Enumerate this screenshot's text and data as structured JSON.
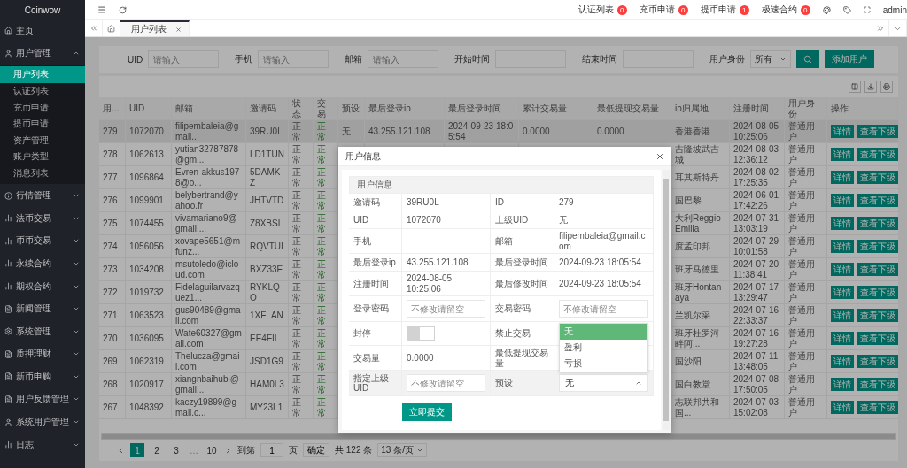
{
  "sidebar": {
    "brand": "Coinwow",
    "items": [
      {
        "label": "主页",
        "kind": "link"
      },
      {
        "label": "用户管理",
        "kind": "group",
        "expanded": true,
        "children": [
          {
            "label": "用户列表",
            "selected": true
          },
          {
            "label": "认证列表",
            "selected": false
          },
          {
            "label": "充币申请",
            "selected": false
          },
          {
            "label": "提币申请",
            "selected": false
          },
          {
            "label": "资产管理",
            "selected": false
          },
          {
            "label": "账户类型",
            "selected": false
          },
          {
            "label": "消息列表",
            "selected": false
          }
        ]
      },
      {
        "label": "行情管理",
        "kind": "group",
        "expanded": false
      },
      {
        "label": "法币交易",
        "kind": "group",
        "expanded": false
      },
      {
        "label": "币币交易",
        "kind": "group",
        "expanded": false
      },
      {
        "label": "永续合约",
        "kind": "group",
        "expanded": false
      },
      {
        "label": "期权合约",
        "kind": "group",
        "expanded": false
      },
      {
        "label": "新闻管理",
        "kind": "group",
        "expanded": false
      },
      {
        "label": "系统管理",
        "kind": "group",
        "expanded": false
      },
      {
        "label": "质押理财",
        "kind": "group",
        "expanded": false
      },
      {
        "label": "新币申购",
        "kind": "group",
        "expanded": false
      },
      {
        "label": "用户反馈管理",
        "kind": "group",
        "expanded": false
      },
      {
        "label": "系统用户管理",
        "kind": "group",
        "expanded": false
      },
      {
        "label": "日志",
        "kind": "group",
        "expanded": false
      }
    ]
  },
  "topbar": {
    "badges": [
      {
        "label": "认证列表",
        "count": "0"
      },
      {
        "label": "充币申请",
        "count": "0"
      },
      {
        "label": "提币申请",
        "count": "1"
      },
      {
        "label": "极速合约",
        "count": "0"
      }
    ],
    "user": "admin"
  },
  "tabs": [
    {
      "label": "用户列表",
      "selected": true
    }
  ],
  "filters": {
    "fields": [
      {
        "label": "UID",
        "placeholder": "请输入"
      },
      {
        "label": "手机",
        "placeholder": "请输入"
      },
      {
        "label": "邮箱",
        "placeholder": "请输入"
      },
      {
        "label": "开始时间"
      },
      {
        "label": "结束时间"
      }
    ],
    "role": {
      "label": "用户身份",
      "value": "所有"
    },
    "add_button": "添加用户"
  },
  "table": {
    "columns": [
      "用...",
      "UID",
      "邮箱",
      "邀请码",
      "状态",
      "交易",
      "预设",
      "最后登录ip",
      "最后登录时间",
      "累计交易量",
      "最低提现交易量",
      "ip归属地",
      "注册时间",
      "用户身份",
      "操作"
    ],
    "rows": [
      {
        "highlighted": true,
        "front": [
          "279",
          "1072070",
          "filipembaleia@gmail...",
          "39RU0L",
          "正常",
          "正常"
        ],
        "middle": [
          "无",
          "43.255.121.108",
          "2024-09-23 18:05:54",
          "0.0000",
          "0.0000"
        ],
        "back": [
          "香港香港",
          "2024-08-05 10:25:06",
          "普通用户"
        ],
        "actions": [
          "详情",
          "查看下级"
        ]
      },
      {
        "highlighted": false,
        "front": [
          "278",
          "1062613",
          "yutian32787878@gm...",
          "LD1TUN",
          "正常",
          "正常"
        ],
        "back": [
          "吉隆坡武吉城",
          "2024-08-03 12:36:12",
          "普通用户"
        ],
        "actions": [
          "详情",
          "查看下级"
        ]
      },
      {
        "highlighted": false,
        "front": [
          "277",
          "1096864",
          "Evren-akkus1978@o...",
          "5DAMKZ",
          "正常",
          "正常"
        ],
        "back": [
          "耳其斯特丹",
          "2024-08-02 17:25:35",
          "普通用户"
        ],
        "actions": [
          "详情",
          "查看下级"
        ]
      },
      {
        "highlighted": false,
        "front": [
          "276",
          "1099901",
          "belybertrand@yahoo.fr",
          "JHTVTD",
          "正常",
          "正常"
        ],
        "back": [
          "国巴黎",
          "2024-06-01 17:42:26",
          "普通用户"
        ],
        "actions": [
          "详情",
          "查看下级"
        ]
      },
      {
        "highlighted": false,
        "front": [
          "275",
          "1074455",
          "vivamariano9@gmail....",
          "Z8XBSL",
          "正常",
          "正常"
        ],
        "back": [
          "大利Reggio Emilia",
          "2024-07-31 13:03:19",
          "普通用户"
        ],
        "actions": [
          "详情",
          "查看下级"
        ]
      },
      {
        "highlighted": false,
        "front": [
          "274",
          "1056056",
          "xovape5651@mfunz...",
          "RQVTUI",
          "正常",
          "正常"
        ],
        "back": [
          "度孟印邦",
          "2024-07-29 10:01:58",
          "普通用户"
        ],
        "actions": [
          "详情",
          "查看下级"
        ]
      },
      {
        "highlighted": false,
        "front": [
          "273",
          "1034208",
          "msutoledo@icloud.com",
          "BXZ33E",
          "正常",
          "正常"
        ],
        "back": [
          "班牙马德里",
          "2024-07-20 11:38:41",
          "普通用户"
        ],
        "actions": [
          "详情",
          "查看下级"
        ]
      },
      {
        "highlighted": false,
        "front": [
          "272",
          "1019732",
          "Fidelaguilarvazquez1...",
          "RYKLQO",
          "正常",
          "正常"
        ],
        "back": [
          "班牙Hontanaya",
          "2024-07-17 13:29:47",
          "普通用户"
        ],
        "actions": [
          "详情",
          "查看下级"
        ]
      },
      {
        "highlighted": false,
        "front": [
          "271",
          "1063523",
          "gus90489@gmail.com",
          "1XFLAN",
          "正常",
          "正常"
        ],
        "back": [
          "兰凯尔采",
          "2024-07-16 22:33:37",
          "普通用户"
        ],
        "actions": [
          "详情",
          "查看下级"
        ]
      },
      {
        "highlighted": false,
        "front": [
          "270",
          "1036095",
          "Wate60327@gmail.com",
          "EE4FII",
          "正常",
          "正常"
        ],
        "back": [
          "班牙杜罗河畔阿...",
          "2024-07-16 19:27:28",
          "普通用户"
        ],
        "actions": [
          "详情",
          "查看下级"
        ]
      },
      {
        "highlighted": false,
        "front": [
          "269",
          "1062319",
          "Thelucza@gmail.com",
          "JSD1G9",
          "正常",
          "正常"
        ],
        "back": [
          "国沙阳",
          "2024-07-11 13:48:05",
          "普通用户"
        ],
        "actions": [
          "详情",
          "查看下级"
        ]
      },
      {
        "highlighted": false,
        "front": [
          "268",
          "1020917",
          "xiangnbaihubi@gmail...",
          "HAM0L3",
          "正常",
          "正常"
        ],
        "back": [
          "国白教堂",
          "2024-07-08 17:50:05",
          "普通用户"
        ],
        "actions": [
          "详情",
          "查看下级"
        ]
      },
      {
        "highlighted": false,
        "front": [
          "267",
          "1048392",
          "kaczy19899@gmail.c...",
          "MY23L1",
          "正常",
          "正常"
        ],
        "back": [
          "志联邦共和国...",
          "2024-07-03 15:02:08",
          "普通用户"
        ],
        "actions": [
          "详情",
          "查看下级"
        ]
      }
    ]
  },
  "pagination": {
    "pages": [
      {
        "label": "1",
        "kind": "page",
        "selected": true
      },
      {
        "label": "2",
        "kind": "page",
        "selected": false
      },
      {
        "label": "3",
        "kind": "page",
        "selected": false
      },
      {
        "label": "…",
        "kind": "ellipsis",
        "selected": false
      },
      {
        "label": "10",
        "kind": "page",
        "selected": false
      }
    ],
    "goto_label": "到第",
    "goto_value": "1",
    "page_unit": "页",
    "confirm": "确定",
    "total": "共 122 条",
    "page_size": "13 条/页"
  },
  "modal": {
    "title": "用户信息",
    "section": "用户信息",
    "submit": "立即提交",
    "rows": [
      {
        "highlighted": false,
        "cells": [
          {
            "kind": "text",
            "label": "邀请码",
            "value": "39RU0L"
          },
          {
            "kind": "text",
            "label": "ID",
            "value": "279"
          }
        ]
      },
      {
        "highlighted": false,
        "cells": [
          {
            "kind": "text",
            "label": "UID",
            "value": "1072070"
          },
          {
            "kind": "text",
            "label": "上级UID",
            "value": "无"
          }
        ]
      },
      {
        "highlighted": false,
        "cells": [
          {
            "kind": "text",
            "label": "手机"
          },
          {
            "kind": "text",
            "label": "邮箱",
            "value": "filipembaleia@gmail.com"
          }
        ]
      },
      {
        "highlighted": false,
        "cells": [
          {
            "kind": "text",
            "label": "最后登录ip",
            "value": "43.255.121.108"
          },
          {
            "kind": "text",
            "label": "最后登录时间",
            "value": "2024-09-23 18:05:54"
          }
        ]
      },
      {
        "highlighted": false,
        "cells": [
          {
            "kind": "text",
            "label": "注册时间",
            "value": "2024-08-05 10:25:06"
          },
          {
            "kind": "text",
            "label": "最后修改时间",
            "value": "2024-09-23 18:05:54"
          }
        ]
      },
      {
        "highlighted": false,
        "cells": [
          {
            "kind": "input",
            "label": "登录密码",
            "placeholder": "不修改请留空"
          },
          {
            "kind": "input",
            "label": "交易密码",
            "placeholder": "不修改请留空"
          }
        ]
      },
      {
        "highlighted": false,
        "cells": [
          {
            "kind": "switch",
            "label": "封停",
            "on": false
          },
          {
            "kind": "text",
            "label": "禁止交易"
          }
        ]
      },
      {
        "highlighted": false,
        "cells": [
          {
            "kind": "text",
            "label": "交易量",
            "value": "0.0000"
          },
          {
            "kind": "text",
            "label": "最低提现交易量"
          }
        ]
      },
      {
        "highlighted": true,
        "cells": [
          {
            "kind": "input",
            "label": "指定上级UID",
            "placeholder": "不修改请留空"
          },
          {
            "kind": "select",
            "label": "预设",
            "value": "无",
            "open": true,
            "options": [
              {
                "label": "无",
                "selected": true
              },
              {
                "label": "盈利",
                "selected": false
              },
              {
                "label": "亏损",
                "selected": false
              }
            ]
          }
        ]
      }
    ]
  }
}
